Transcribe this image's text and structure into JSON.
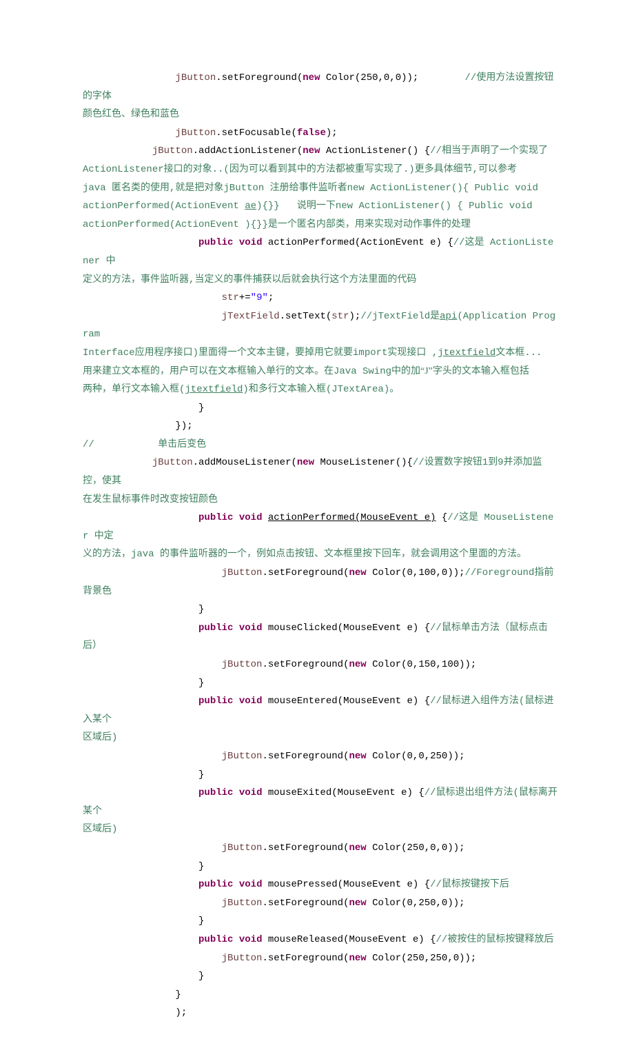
{
  "lines": [
    {
      "indent": 16,
      "segments": [
        {
          "cls": "var",
          "text": "jButton"
        },
        {
          "cls": "plain",
          "text": ".setForeground("
        },
        {
          "cls": "kw",
          "text": "new"
        },
        {
          "cls": "plain",
          "text": " Color(250,0,0));        "
        },
        {
          "cls": "cmt",
          "text": "//使用方法设置按钮的字体"
        }
      ]
    },
    {
      "indent": 0,
      "segments": [
        {
          "cls": "cmt",
          "text": "颜色红色、绿色和蓝色"
        }
      ]
    },
    {
      "indent": 16,
      "segments": [
        {
          "cls": "var",
          "text": "jButton"
        },
        {
          "cls": "plain",
          "text": ".setFocusable("
        },
        {
          "cls": "kw",
          "text": "false"
        },
        {
          "cls": "plain",
          "text": ");"
        }
      ]
    },
    {
      "indent": 12,
      "segments": [
        {
          "cls": "var",
          "text": "jButton"
        },
        {
          "cls": "plain",
          "text": ".addActionListener("
        },
        {
          "cls": "kw",
          "text": "new"
        },
        {
          "cls": "plain",
          "text": " ActionListener() {"
        },
        {
          "cls": "cmt",
          "text": "//相当于声明了一个实现了"
        }
      ]
    },
    {
      "indent": 0,
      "segments": [
        {
          "cls": "cmt",
          "text": "ActionListener接口的对象..(因为可以看到其中的方法都被重写实现了.)更多具体细节,可以参考"
        }
      ]
    },
    {
      "indent": 0,
      "segments": [
        {
          "cls": "cmt",
          "text": "java 匿名类的使用,就是把对象jButton 注册给事件监听者new ActionListener(){ Public void "
        }
      ]
    },
    {
      "indent": 0,
      "segments": [
        {
          "cls": "cmt",
          "text": "actionPerformed(ActionEvent "
        },
        {
          "cls": "cmt underline",
          "text": "ae"
        },
        {
          "cls": "cmt",
          "text": "){}}   说明一下new ActionListener() { Public void "
        }
      ]
    },
    {
      "indent": 0,
      "segments": [
        {
          "cls": "cmt",
          "text": "actionPerformed(ActionEvent ){}}是一个匿名内部类，用来实现对动作事件的处理"
        }
      ]
    },
    {
      "indent": 20,
      "segments": [
        {
          "cls": "kw",
          "text": "public"
        },
        {
          "cls": "plain",
          "text": " "
        },
        {
          "cls": "kw",
          "text": "void"
        },
        {
          "cls": "plain",
          "text": " actionPerformed(ActionEvent e) {"
        },
        {
          "cls": "cmt",
          "text": "//这是 ActionListener 中"
        }
      ]
    },
    {
      "indent": 0,
      "segments": [
        {
          "cls": "cmt",
          "text": "定义的方法，事件监听器,当定义的事件捕获以后就会执行这个方法里面的代码"
        }
      ]
    },
    {
      "indent": 24,
      "segments": [
        {
          "cls": "var",
          "text": "str"
        },
        {
          "cls": "plain",
          "text": "+="
        },
        {
          "cls": "str",
          "text": "\"9\""
        },
        {
          "cls": "plain",
          "text": ";"
        }
      ]
    },
    {
      "indent": 24,
      "segments": [
        {
          "cls": "var",
          "text": "jTextField"
        },
        {
          "cls": "plain",
          "text": ".setText("
        },
        {
          "cls": "var",
          "text": "str"
        },
        {
          "cls": "plain",
          "text": ");"
        },
        {
          "cls": "cmt",
          "text": "//jTextField是"
        },
        {
          "cls": "cmt underline",
          "text": "api"
        },
        {
          "cls": "cmt",
          "text": "(Application Program "
        }
      ]
    },
    {
      "indent": 0,
      "segments": [
        {
          "cls": "cmt",
          "text": "Interface应用程序接口)里面得一个文本主键，要掉用它就要import实现接口 ,"
        },
        {
          "cls": "cmt underline",
          "text": "jtextfield"
        },
        {
          "cls": "cmt",
          "text": "文本框..."
        }
      ]
    },
    {
      "indent": 0,
      "segments": [
        {
          "cls": "cmt",
          "text": "用来建立文本框的，用户可以在文本框输入单行的文本。在Java Swing中的加"
        },
        {
          "cls": "cmt quotes",
          "text": "“J”"
        },
        {
          "cls": "cmt",
          "text": "字头的文本输入框包括"
        }
      ]
    },
    {
      "indent": 0,
      "segments": [
        {
          "cls": "cmt",
          "text": "两种，单行文本输入框("
        },
        {
          "cls": "cmt underline",
          "text": "jtextfield"
        },
        {
          "cls": "cmt",
          "text": ")和多行文本输入框(JTextArea)。"
        }
      ]
    },
    {
      "indent": 20,
      "segments": [
        {
          "cls": "plain",
          "text": "}"
        }
      ]
    },
    {
      "indent": 16,
      "segments": [
        {
          "cls": "plain",
          "text": "});"
        }
      ]
    },
    {
      "indent": 0,
      "segments": [
        {
          "cls": "cmt",
          "text": "//           单击后变色"
        }
      ]
    },
    {
      "indent": 12,
      "segments": [
        {
          "cls": "var",
          "text": "jButton"
        },
        {
          "cls": "plain",
          "text": ".addMouseListener("
        },
        {
          "cls": "kw",
          "text": "new"
        },
        {
          "cls": "plain",
          "text": " MouseListener(){"
        },
        {
          "cls": "cmt",
          "text": "//设置数字按钮1到9并添加监控，使其"
        }
      ]
    },
    {
      "indent": 0,
      "segments": [
        {
          "cls": "cmt",
          "text": "在发生鼠标事件时改变按钮颜色"
        }
      ]
    },
    {
      "indent": 20,
      "segments": [
        {
          "cls": "kw",
          "text": "public"
        },
        {
          "cls": "plain",
          "text": " "
        },
        {
          "cls": "kw",
          "text": "void"
        },
        {
          "cls": "plain",
          "text": " "
        },
        {
          "cls": "plain underline",
          "text": "actionPerformed(MouseEvent e)"
        },
        {
          "cls": "plain",
          "text": " {"
        },
        {
          "cls": "cmt",
          "text": "//这是 MouseListener 中定"
        }
      ]
    },
    {
      "indent": 0,
      "segments": [
        {
          "cls": "cmt",
          "text": "义的方法，java 的事件监听器的一个，例如点击按钮、文本框里按下回车，就会调用这个里面的方法。"
        }
      ]
    },
    {
      "indent": 24,
      "segments": [
        {
          "cls": "var",
          "text": "jButton"
        },
        {
          "cls": "plain",
          "text": ".setForeground("
        },
        {
          "cls": "kw",
          "text": "new"
        },
        {
          "cls": "plain",
          "text": " Color(0,100,0));"
        },
        {
          "cls": "cmt",
          "text": "//Foreground指前背景色"
        }
      ]
    },
    {
      "indent": 20,
      "segments": [
        {
          "cls": "plain",
          "text": "}"
        }
      ]
    },
    {
      "indent": 20,
      "segments": [
        {
          "cls": "kw",
          "text": "public"
        },
        {
          "cls": "plain",
          "text": " "
        },
        {
          "cls": "kw",
          "text": "void"
        },
        {
          "cls": "plain",
          "text": " mouseClicked(MouseEvent e) {"
        },
        {
          "cls": "cmt",
          "text": "//鼠标单击方法（鼠标点击后）"
        }
      ]
    },
    {
      "indent": 24,
      "segments": [
        {
          "cls": "var",
          "text": "jButton"
        },
        {
          "cls": "plain",
          "text": ".setForeground("
        },
        {
          "cls": "kw",
          "text": "new"
        },
        {
          "cls": "plain",
          "text": " Color(0,150,100));"
        }
      ]
    },
    {
      "indent": 20,
      "segments": [
        {
          "cls": "plain",
          "text": "}"
        }
      ]
    },
    {
      "indent": 20,
      "segments": [
        {
          "cls": "kw",
          "text": "public"
        },
        {
          "cls": "plain",
          "text": " "
        },
        {
          "cls": "kw",
          "text": "void"
        },
        {
          "cls": "plain",
          "text": " mouseEntered(MouseEvent e) {"
        },
        {
          "cls": "cmt",
          "text": "//鼠标进入组件方法(鼠标进入某个"
        }
      ]
    },
    {
      "indent": 0,
      "segments": [
        {
          "cls": "cmt",
          "text": "区域后)"
        }
      ]
    },
    {
      "indent": 24,
      "segments": [
        {
          "cls": "var",
          "text": "jButton"
        },
        {
          "cls": "plain",
          "text": ".setForeground("
        },
        {
          "cls": "kw",
          "text": "new"
        },
        {
          "cls": "plain",
          "text": " Color(0,0,250));"
        }
      ]
    },
    {
      "indent": 20,
      "segments": [
        {
          "cls": "plain",
          "text": "}"
        }
      ]
    },
    {
      "indent": 20,
      "segments": [
        {
          "cls": "kw",
          "text": "public"
        },
        {
          "cls": "plain",
          "text": " "
        },
        {
          "cls": "kw",
          "text": "void"
        },
        {
          "cls": "plain",
          "text": " mouseExited(MouseEvent e) {"
        },
        {
          "cls": "cmt",
          "text": "//鼠标退出组件方法(鼠标离开某个"
        }
      ]
    },
    {
      "indent": 0,
      "segments": [
        {
          "cls": "cmt",
          "text": "区域后)"
        }
      ]
    },
    {
      "indent": 24,
      "segments": [
        {
          "cls": "var",
          "text": "jButton"
        },
        {
          "cls": "plain",
          "text": ".setForeground("
        },
        {
          "cls": "kw",
          "text": "new"
        },
        {
          "cls": "plain",
          "text": " Color(250,0,0));"
        }
      ]
    },
    {
      "indent": 20,
      "segments": [
        {
          "cls": "plain",
          "text": "}"
        }
      ]
    },
    {
      "indent": 20,
      "segments": [
        {
          "cls": "kw",
          "text": "public"
        },
        {
          "cls": "plain",
          "text": " "
        },
        {
          "cls": "kw",
          "text": "void"
        },
        {
          "cls": "plain",
          "text": " mousePressed(MouseEvent e) {"
        },
        {
          "cls": "cmt",
          "text": "//鼠标按键按下后"
        }
      ]
    },
    {
      "indent": 24,
      "segments": [
        {
          "cls": "var",
          "text": "jButton"
        },
        {
          "cls": "plain",
          "text": ".setForeground("
        },
        {
          "cls": "kw",
          "text": "new"
        },
        {
          "cls": "plain",
          "text": " Color(0,250,0));"
        }
      ]
    },
    {
      "indent": 20,
      "segments": [
        {
          "cls": "plain",
          "text": "}"
        }
      ]
    },
    {
      "indent": 20,
      "segments": [
        {
          "cls": "kw",
          "text": "public"
        },
        {
          "cls": "plain",
          "text": " "
        },
        {
          "cls": "kw",
          "text": "void"
        },
        {
          "cls": "plain",
          "text": " mouseReleased(MouseEvent e) {"
        },
        {
          "cls": "cmt",
          "text": "//被按住的鼠标按键释放后"
        }
      ]
    },
    {
      "indent": 24,
      "segments": [
        {
          "cls": "var",
          "text": "jButton"
        },
        {
          "cls": "plain",
          "text": ".setForeground("
        },
        {
          "cls": "kw",
          "text": "new"
        },
        {
          "cls": "plain",
          "text": " Color(250,250,0));"
        }
      ]
    },
    {
      "indent": 20,
      "segments": [
        {
          "cls": "plain",
          "text": "}"
        }
      ]
    },
    {
      "indent": 16,
      "segments": [
        {
          "cls": "plain",
          "text": "}"
        }
      ]
    },
    {
      "indent": 16,
      "segments": [
        {
          "cls": "plain",
          "text": ");"
        }
      ]
    }
  ]
}
